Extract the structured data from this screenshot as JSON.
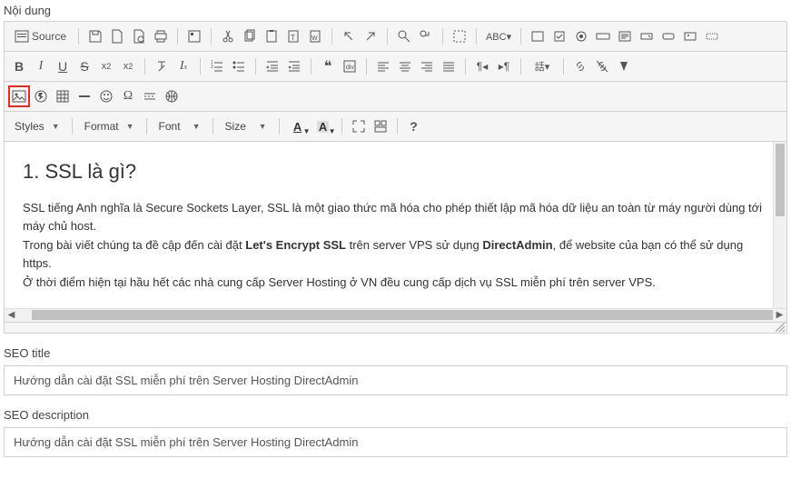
{
  "labels": {
    "content": "Nội dung",
    "seo_title": "SEO title",
    "seo_description": "SEO description"
  },
  "toolbar": {
    "source": "Source",
    "styles": "Styles",
    "format": "Format",
    "font": "Font",
    "size": "Size"
  },
  "content": {
    "heading": "1. SSL là gì?",
    "p1a": "SSL tiếng Anh nghĩa là Secure Sockets Layer, SSL là một giao thức mã hóa cho phép thiết lập mã hóa dữ liệu an toàn từ máy người dùng tới máy chủ host.",
    "p2a": "Trong bài viết chúng ta đề cập đến cài đặt ",
    "p2b": "Let's Encrypt SSL",
    "p2c": " trên server VPS sử dụng ",
    "p2d": "DirectAdmin",
    "p2e": ", để website của bạn có thể sử dụng https.",
    "p3": "Ở thời điểm hiện tại hầu hết các nhà cung cấp Server Hosting ở VN đều cung cấp dịch vụ SSL miễn phí trên server VPS."
  },
  "seo": {
    "title_value": "Hướng dẫn cài đặt SSL miễn phí trên Server Hosting DirectAdmin",
    "desc_value": "Hướng dẫn cài đặt SSL miễn phí trên Server Hosting DirectAdmin"
  }
}
